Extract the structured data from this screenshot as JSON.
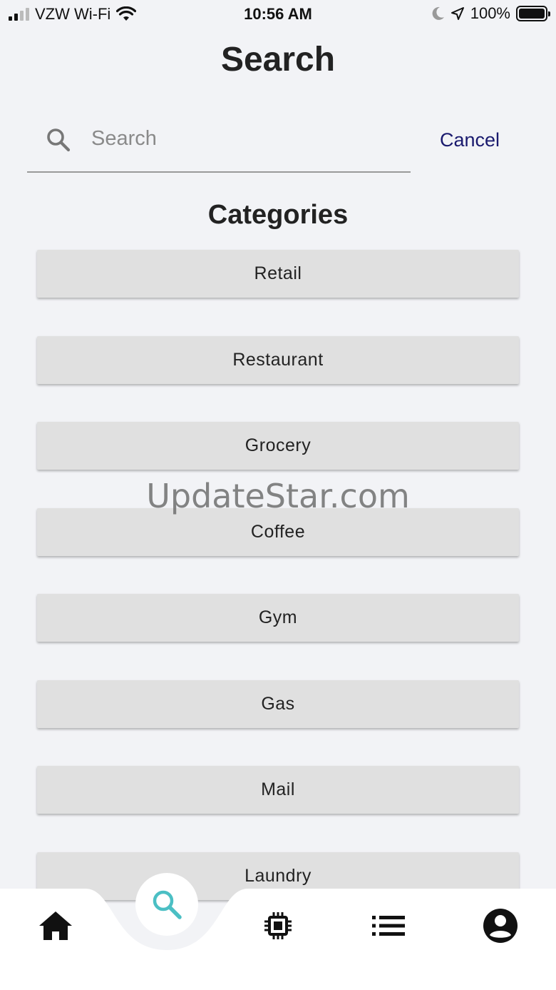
{
  "status_bar": {
    "carrier": "VZW Wi-Fi",
    "time": "10:56 AM",
    "battery": "100%"
  },
  "header": {
    "title": "Search"
  },
  "search": {
    "placeholder": "Search",
    "value": "",
    "cancel_label": "Cancel"
  },
  "categories": {
    "title": "Categories",
    "items": [
      {
        "label": "Retail"
      },
      {
        "label": "Restaurant"
      },
      {
        "label": "Grocery"
      },
      {
        "label": "Coffee"
      },
      {
        "label": "Gym"
      },
      {
        "label": "Gas"
      },
      {
        "label": "Mail"
      },
      {
        "label": "Laundry"
      }
    ]
  },
  "watermark": "UpdateStar.com",
  "bottom_nav": {
    "items": [
      {
        "icon": "home-icon"
      },
      {
        "icon": "search-icon",
        "active": true
      },
      {
        "icon": "chip-icon"
      },
      {
        "icon": "list-icon"
      },
      {
        "icon": "account-icon"
      }
    ],
    "active_color": "#4bbfc4"
  },
  "colors": {
    "background": "#f2f3f6",
    "button": "#e0e0e0",
    "cancel": "#1a1a6e"
  }
}
